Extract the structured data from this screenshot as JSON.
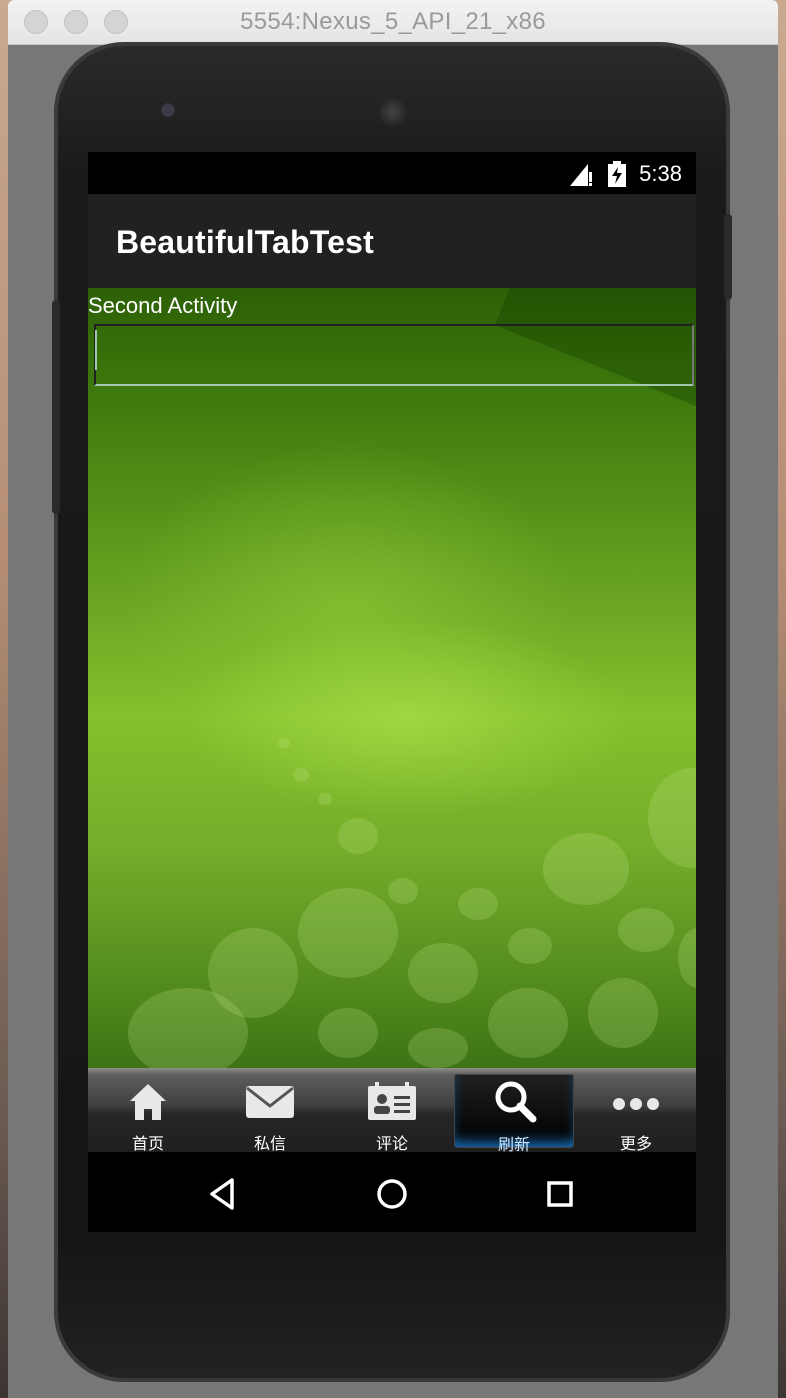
{
  "window": {
    "title": "5554:Nexus_5_API_21_x86"
  },
  "status_bar": {
    "time": "5:38"
  },
  "action_bar": {
    "title": "BeautifulTabTest"
  },
  "content": {
    "label": "Second Activity",
    "input_value": ""
  },
  "tabs": [
    {
      "label": "首页",
      "icon": "home-icon",
      "selected": false
    },
    {
      "label": "私信",
      "icon": "mail-icon",
      "selected": false
    },
    {
      "label": "评论",
      "icon": "contact-card-icon",
      "selected": false
    },
    {
      "label": "刷新",
      "icon": "search-icon",
      "selected": true
    },
    {
      "label": "更多",
      "icon": "more-icon",
      "selected": false
    }
  ],
  "navigation": {
    "back": "back-icon",
    "home": "home-circle-icon",
    "recents": "recents-icon"
  },
  "colors": {
    "accent": "#1a7ad0",
    "content_green": "#84c02d",
    "action_bar": "#212121"
  }
}
